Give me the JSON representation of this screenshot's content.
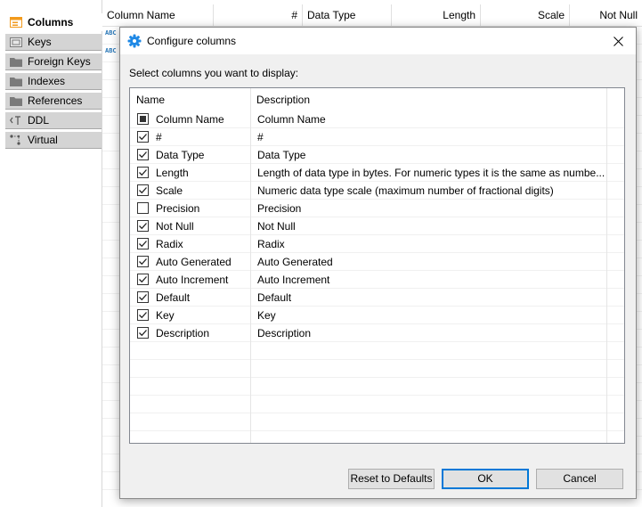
{
  "sidebar": {
    "items": [
      {
        "label": "Columns",
        "icon": "columns-icon",
        "active": true
      },
      {
        "label": "Keys",
        "icon": "keys-icon"
      },
      {
        "label": "Foreign Keys",
        "icon": "folder-icon"
      },
      {
        "label": "Indexes",
        "icon": "folder-icon"
      },
      {
        "label": "References",
        "icon": "folder-icon"
      },
      {
        "label": "DDL",
        "icon": "ddl-icon"
      },
      {
        "label": "Virtual",
        "icon": "virtual-icon"
      }
    ]
  },
  "grid": {
    "headers": [
      "Column Name",
      "#",
      "Data Type",
      "Length",
      "Scale",
      "Not Null"
    ],
    "row_badge": "ABC"
  },
  "dialog": {
    "title": "Configure columns",
    "prompt": "Select columns you want to display:",
    "table": {
      "headers": {
        "name": "Name",
        "description": "Description"
      },
      "rows": [
        {
          "name": "Column Name",
          "description": "Column Name",
          "state": "partial"
        },
        {
          "name": "#",
          "description": "#",
          "state": "checked"
        },
        {
          "name": "Data Type",
          "description": "Data Type",
          "state": "checked"
        },
        {
          "name": "Length",
          "description": "Length of data type in bytes. For numeric types it is the same as numbe...",
          "state": "checked"
        },
        {
          "name": "Scale",
          "description": "Numeric data type scale (maximum number of fractional digits)",
          "state": "checked"
        },
        {
          "name": "Precision",
          "description": "Precision",
          "state": "unchecked"
        },
        {
          "name": "Not Null",
          "description": "Not Null",
          "state": "checked"
        },
        {
          "name": "Radix",
          "description": "Radix",
          "state": "checked"
        },
        {
          "name": "Auto Generated",
          "description": "Auto Generated",
          "state": "checked"
        },
        {
          "name": "Auto Increment",
          "description": "Auto Increment",
          "state": "checked"
        },
        {
          "name": "Default",
          "description": "Default",
          "state": "checked"
        },
        {
          "name": "Key",
          "description": "Key",
          "state": "checked"
        },
        {
          "name": "Description",
          "description": "Description",
          "state": "checked"
        }
      ]
    },
    "buttons": {
      "reset": "Reset to Defaults",
      "ok": "OK",
      "cancel": "Cancel"
    }
  },
  "colors": {
    "accent": "#0078d7",
    "tab_bg": "#d4d4d4",
    "dialog_bg": "#f0f0f0",
    "column_icon": "#f29a1c",
    "folder_icon": "#7a7a7a"
  }
}
